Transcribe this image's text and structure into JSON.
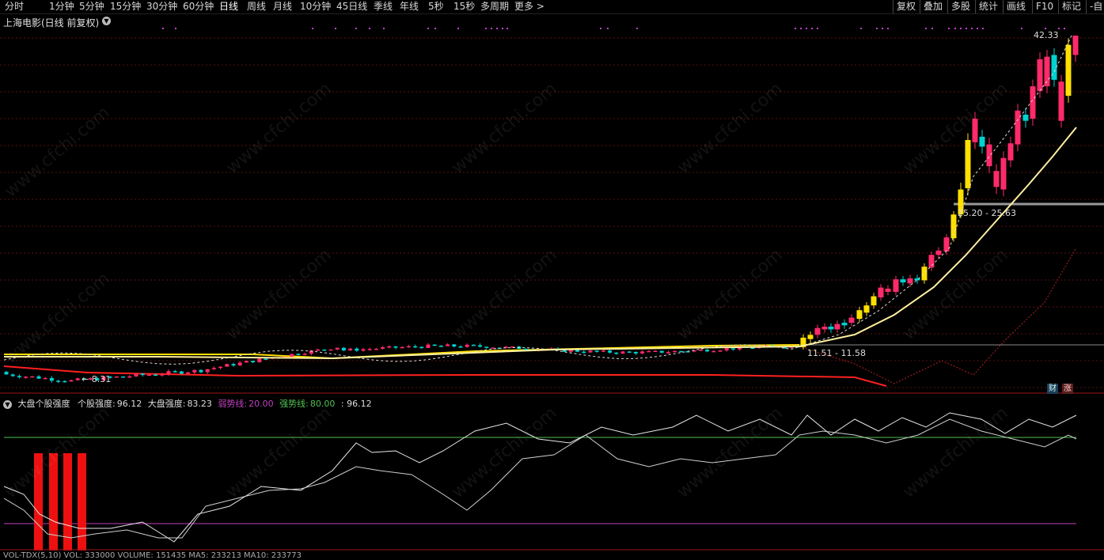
{
  "toolbar": {
    "periods": [
      "分时",
      "1分钟",
      "5分钟",
      "15分钟",
      "30分钟",
      "60分钟",
      "日线",
      "周线",
      "月线",
      "10分钟",
      "45日线",
      "季线",
      "年线",
      "5秒",
      "15秒",
      "多周期",
      "更多 >"
    ],
    "active_period": "日线",
    "right_buttons": [
      "复权",
      "叠加",
      "多股",
      "统计",
      "画线",
      "F10",
      "标记",
      "-自"
    ]
  },
  "chart": {
    "title": "上海电影(日线 前复权)",
    "high_label": "42.33",
    "low_label": "8.31",
    "band_label_1": "25.20 - 25.63",
    "band_label_2": "11.51 - 11.58",
    "badge_cai": "财",
    "badge_zhang": "涨",
    "watermark": "www.cfchi.com",
    "colors": {
      "up": "#ff2a6a",
      "down": "#00d2d2",
      "yellow": "#ffe000",
      "ma": "#fff0a0",
      "red_line": "#ff2020"
    }
  },
  "indicator": {
    "name": "大盘个股强度",
    "stock_label": "个股强度:",
    "stock_value": "96.12",
    "market_label": "大盘强度:",
    "market_value": "83.23",
    "weak_label": "弱势线:",
    "weak_value": "20.00",
    "strong_label": "强势线:",
    "strong_value": "80.00",
    "extra_value": ": 96.12",
    "colors": {
      "weak": "#c040c0",
      "strong": "#50c050"
    }
  },
  "volume": {
    "header": "VOL-TDX(5,10) VOL: 333000 VOLUME: 151435 MA5: 233213 MA10: 233773"
  }
}
